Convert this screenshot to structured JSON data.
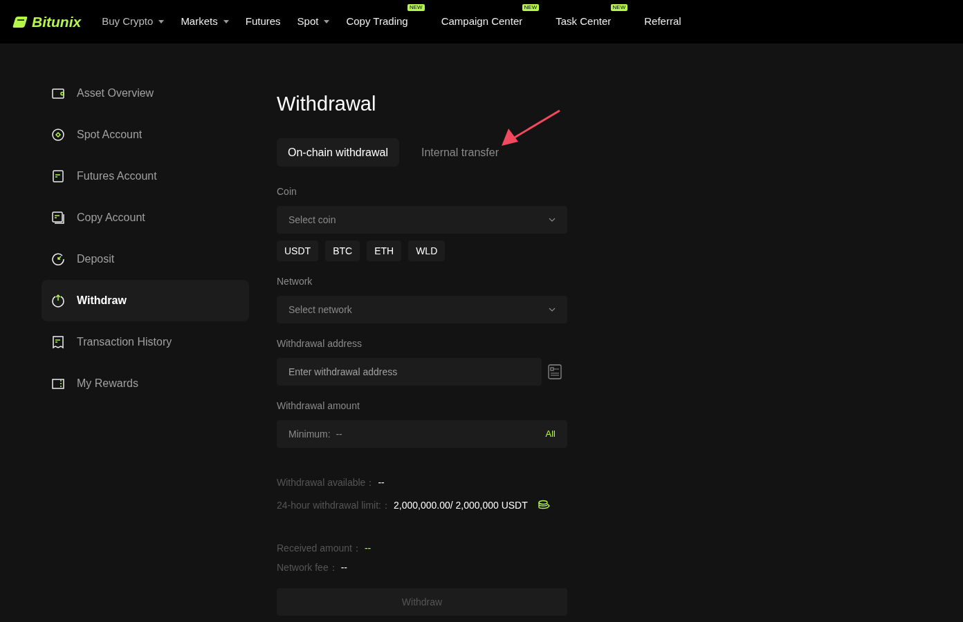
{
  "header": {
    "logo": "Bitunix",
    "nav": [
      {
        "label": "Buy Crypto",
        "dropdown": true
      },
      {
        "label": "Markets",
        "dropdown": true
      },
      {
        "label": "Futures",
        "dropdown": false
      },
      {
        "label": "Spot",
        "dropdown": true
      },
      {
        "label": "Copy Trading",
        "dropdown": false,
        "badge": "NEW"
      },
      {
        "label": "Campaign Center",
        "dropdown": false,
        "badge": "NEW"
      },
      {
        "label": "Task Center",
        "dropdown": false,
        "badge": "NEW"
      },
      {
        "label": "Referral",
        "dropdown": false
      }
    ]
  },
  "sidebar": {
    "items": [
      {
        "label": "Asset Overview",
        "selected": false
      },
      {
        "label": "Spot Account",
        "selected": false
      },
      {
        "label": "Futures Account",
        "selected": false
      },
      {
        "label": "Copy Account",
        "selected": false
      },
      {
        "label": "Deposit",
        "selected": false
      },
      {
        "label": "Withdraw",
        "selected": true
      },
      {
        "label": "Transaction History",
        "selected": false
      },
      {
        "label": "My Rewards",
        "selected": false
      }
    ]
  },
  "main": {
    "title": "Withdrawal",
    "tabs": [
      {
        "label": "On-chain withdrawal",
        "selected": true
      },
      {
        "label": "Internal transfer",
        "selected": false
      }
    ],
    "coin": {
      "label": "Coin",
      "placeholder": "Select coin",
      "chips": [
        "USDT",
        "BTC",
        "ETH",
        "WLD"
      ]
    },
    "network": {
      "label": "Network",
      "placeholder": "Select network"
    },
    "address": {
      "label": "Withdrawal address",
      "placeholder": "Enter withdrawal address"
    },
    "amount": {
      "label": "Withdrawal amount",
      "placeholder": "Minimum:  --",
      "all": "All"
    },
    "limits": [
      {
        "caption": "Withdrawal available：",
        "reading": "--",
        "highlighted": false
      },
      {
        "caption": "24-hour withdrawal limit:：",
        "reading": "2,000,000.00/ 2,000,000 USDT",
        "highlighted": false
      }
    ],
    "summary": [
      {
        "caption": "Received amount：",
        "reading": "--",
        "highlighted": true
      },
      {
        "caption": "Network fee：",
        "reading": "--",
        "highlighted": false
      }
    ],
    "submit": {
      "label": "Withdraw",
      "disabled": true
    }
  }
}
